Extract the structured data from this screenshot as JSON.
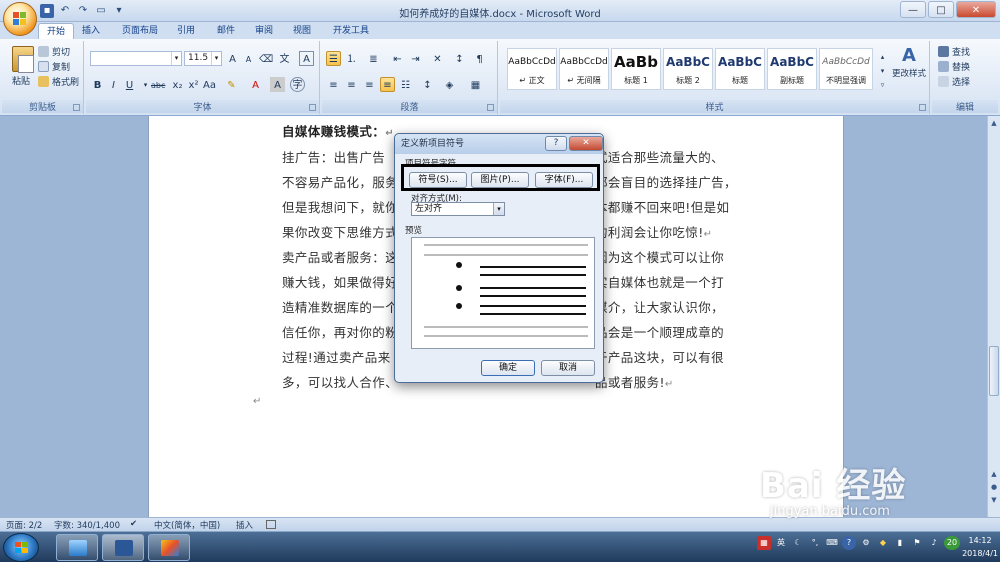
{
  "window": {
    "title": "如何养成好的自媒体.docx - Microsoft Word",
    "minimize": "—",
    "maximize": "□",
    "close": "✕"
  },
  "tabs": [
    "开始",
    "插入",
    "页面布局",
    "引用",
    "邮件",
    "审阅",
    "视图",
    "开发工具"
  ],
  "ribbon": {
    "clipboard": {
      "label": "剪贴板",
      "paste": "粘贴",
      "cut": "剪切",
      "copy": "复制",
      "format_painter": "格式刷"
    },
    "font": {
      "label": "字体",
      "font_name": "",
      "font_size": "11.5"
    },
    "paragraph": {
      "label": "段落"
    },
    "styles": {
      "label": "样式",
      "items": [
        {
          "sample": "AaBbCcDd",
          "name": "↵ 正文"
        },
        {
          "sample": "AaBbCcDd",
          "name": "↵ 无间隔"
        },
        {
          "sample": "AaBb",
          "name": "标题 1"
        },
        {
          "sample": "AaBbC",
          "name": "标题 2"
        },
        {
          "sample": "AaBbC",
          "name": "标题"
        },
        {
          "sample": "AaBbC",
          "name": "副标题"
        },
        {
          "sample": "AaBbCcDd",
          "name": "不明显强调"
        }
      ],
      "change_styles": "更改样式"
    },
    "editing": {
      "label": "编辑",
      "find": "查找",
      "replace": "替换",
      "select": "选择"
    }
  },
  "document": {
    "lines": [
      {
        "text": "自媒体赚钱模式：",
        "bold": true
      },
      {
        "text": "挂广告：出售广告",
        "right": "式适合那些流量大的、"
      },
      {
        "text": "不容易产品化，服务",
        "right": "都会盲目的选择挂广告，"
      },
      {
        "text": "但是我想问下，就你",
        "right": "本都赚不回来吧!但是如"
      },
      {
        "text": "果你改变下思维方式",
        "right": "的利润会让你吃惊!"
      },
      {
        "text": "卖产品或者服务：这",
        "right": "因为这个模式可以让你"
      },
      {
        "text": "赚大钱，如果做得好",
        "right": "实自媒体也就是一个打"
      },
      {
        "text": "造精准数据库的一个",
        "right": "媒介，让大家认识你，"
      },
      {
        "text": "信任你，再对你的粉",
        "right": "品会是一个顺理成章的"
      },
      {
        "text": "过程!通过卖产品来",
        "right": "于产品这块，可以有很"
      },
      {
        "text": "多，可以找人合作、",
        "right": "品或者服务!"
      }
    ]
  },
  "dialog": {
    "title": "定义新项目符号",
    "help": "?",
    "close": "✕",
    "section_bullet": "项目符号字符",
    "btn_symbol": "符号(S)...",
    "btn_picture": "图片(P)...",
    "btn_font": "字体(F)...",
    "section_align": "对齐方式(M):",
    "align_value": "左对齐",
    "section_preview": "预览",
    "btn_ok": "确定",
    "btn_cancel": "取消"
  },
  "statusbar": {
    "page": "页面: 2/2",
    "words": "字数: 340/1,400",
    "language": "中文(简体，中国)",
    "insert": "插入"
  },
  "taskbar": {
    "ime": "英",
    "battery": "20",
    "time": "14:12",
    "date": "2018/4/1"
  },
  "watermark": {
    "brand": "Bai 经验",
    "url": "jingyan.baidu.com"
  },
  "colors": {
    "accent": "#15428b",
    "ribbon_bg": "#dfe9f5",
    "highlight": "#000000"
  }
}
